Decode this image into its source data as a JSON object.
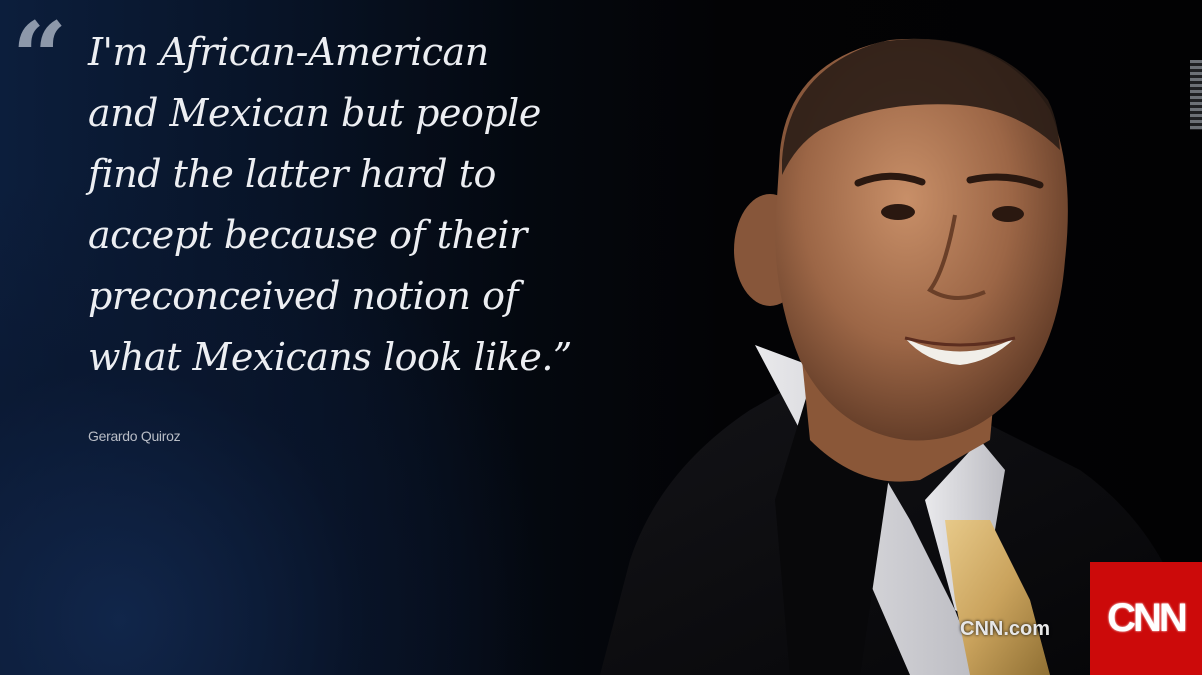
{
  "quote": {
    "mark": "“",
    "lines": [
      "I'm African-American",
      "and Mexican but people",
      "find the latter hard to",
      "accept because of their",
      "preconceived notion of",
      "what Mexicans look like.”"
    ],
    "attribution": "Gerardo Quiroz"
  },
  "branding": {
    "domain": "CNN.com",
    "logo": "CNN",
    "logo_color": "#cc0a0a"
  },
  "image": {
    "subject": "portrait-photo",
    "icons": [
      "quote-icon",
      "cnn-logo"
    ]
  }
}
